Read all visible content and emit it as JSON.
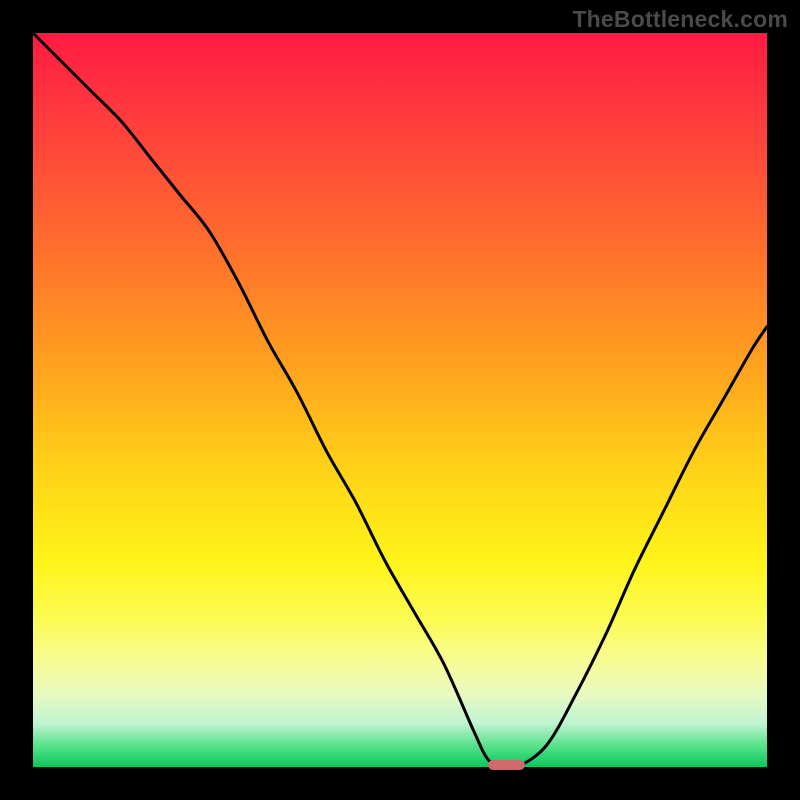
{
  "watermark": "TheBottleneck.com",
  "colors": {
    "frame": "#000000",
    "curve": "#000000",
    "marker": "#cf6a6d"
  },
  "chart_data": {
    "type": "line",
    "title": "",
    "xlabel": "",
    "ylabel": "",
    "xlim": [
      0,
      100
    ],
    "ylim": [
      0,
      100
    ],
    "note": "Axes are unlabeled in the image; x is normalized position 0–100 left→right, y is normalized height 0 at bottom, 100 at top. Values estimated from pixel coordinates.",
    "x": [
      0,
      4,
      8,
      12,
      16,
      20,
      24,
      28,
      32,
      36,
      40,
      44,
      48,
      52,
      56,
      60,
      62,
      64,
      66,
      70,
      74,
      78,
      82,
      86,
      90,
      94,
      98,
      100
    ],
    "y": [
      100,
      96,
      92,
      88,
      83,
      78,
      73,
      66,
      58,
      51,
      43,
      36,
      28,
      21,
      14,
      5,
      1,
      0,
      0,
      3,
      10,
      18,
      27,
      35,
      43,
      50,
      57,
      60
    ],
    "marker": {
      "x_start": 62,
      "x_end": 67,
      "y": 0
    }
  }
}
